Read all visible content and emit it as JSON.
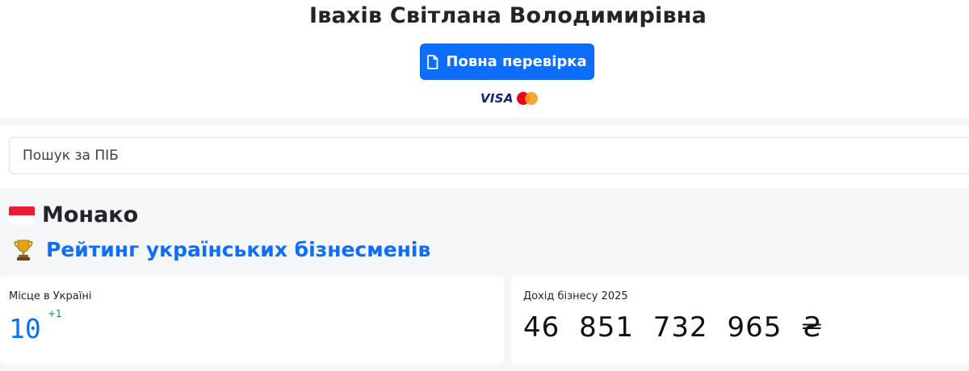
{
  "person": {
    "name": "Івахів Світлана Володимирівна"
  },
  "actions": {
    "full_check_label": "Повна перевірка",
    "full_check_icon": "document-icon"
  },
  "payment": {
    "visa_label": "VISA",
    "mastercard_icon": "mastercard-icon"
  },
  "search": {
    "placeholder": "Пошук за ПІБ",
    "value": ""
  },
  "country": {
    "name": "Монако",
    "flag_colors": [
      "#ec1b35",
      "#ffffff"
    ]
  },
  "rating": {
    "label": "Рейтинг українських бізнесменів",
    "icon": "trophy-icon"
  },
  "stats": {
    "place_label": "Місце в Україні",
    "place_value": "10",
    "place_delta": "+1",
    "income_label": "Дохід бізнесу 2025",
    "income_value": "46 851 732 965 ₴"
  },
  "colors": {
    "accent": "#0d6efd",
    "positive": "#198754",
    "section_bg": "#f5f6f8"
  }
}
